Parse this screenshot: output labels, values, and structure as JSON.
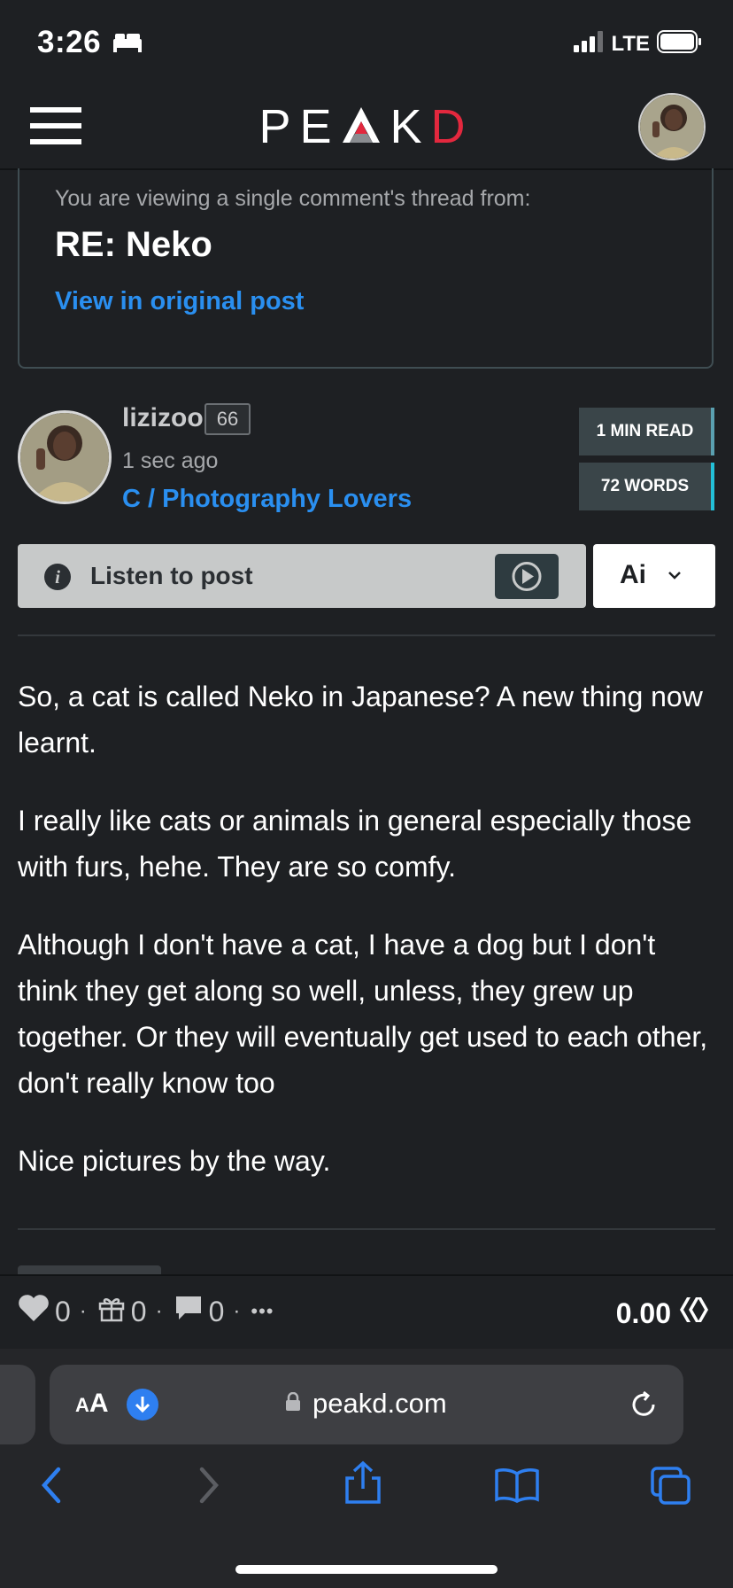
{
  "status_bar": {
    "time": "3:26",
    "network": "LTE",
    "icons": [
      "bed-icon",
      "signal-icon",
      "battery-icon"
    ]
  },
  "header": {
    "logo_prefix": "PE",
    "logo_middle": "K",
    "logo_suffix": "D",
    "menu_icon": "hamburger-icon",
    "colors": {
      "logo_accent": "#e3283e",
      "header_bg": "#1e2023"
    }
  },
  "thread": {
    "intro": "You are viewing a single comment's thread from:",
    "title": "RE: Neko",
    "link": "View in original post"
  },
  "author": {
    "name": "lizizoo",
    "reputation": "66",
    "time": "1 sec ago",
    "community": "C / Photography Lovers"
  },
  "stats": {
    "read_time": "1 MIN READ",
    "words": "72 WORDS"
  },
  "listen": {
    "label": "Listen to post",
    "ai_label": "Ai"
  },
  "post": {
    "paragraphs": [
      "So, a cat is called Neko in Japanese? A new thing now learnt.",
      "I really like cats or animals in general especially those with furs, hehe. They are so comfy.",
      "Although I don't have a cat, I have a dog but I don't think they get along so well, unless, they grew up together. Or they will eventually get used to each other, don't really know too",
      "Nice pictures by the way."
    ]
  },
  "actions": {
    "votes": "0",
    "gifts": "0",
    "comments": "0",
    "more": "•••",
    "separator": "·",
    "payout": "0.00"
  },
  "browser": {
    "aa_small": "A",
    "aa_large": "A",
    "url": "peakd.com",
    "colors": {
      "accent": "#2e7ff0"
    }
  }
}
